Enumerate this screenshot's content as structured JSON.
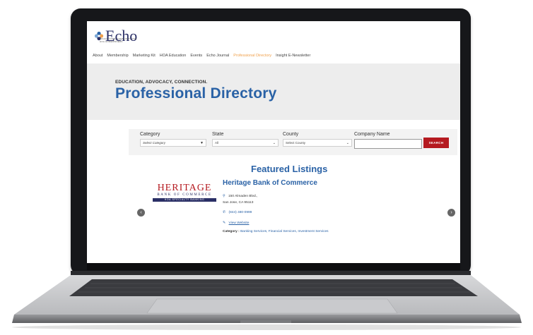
{
  "site": {
    "logo": {
      "word": "Echo",
      "tagline": "EDUCATIONAL COMMUNITY FOR HOA HOMEOWNERS"
    },
    "nav": [
      {
        "label": "About",
        "active": false
      },
      {
        "label": "Membership",
        "active": false
      },
      {
        "label": "Marketing Kit",
        "active": false
      },
      {
        "label": "HOA Education",
        "active": false
      },
      {
        "label": "Events",
        "active": false
      },
      {
        "label": "Echo Journal",
        "active": false
      },
      {
        "label": "Professional Directory",
        "active": true
      },
      {
        "label": "Insight E-Newsletter",
        "active": false
      }
    ],
    "hero": {
      "eyebrow": "EDUCATION, ADVOCACY, CONNECTION.",
      "title": "Professional Directory"
    },
    "filters": {
      "category": {
        "label": "Category",
        "value": "Select Category"
      },
      "state": {
        "label": "State",
        "value": "All"
      },
      "county": {
        "label": "County",
        "value": "Select County"
      },
      "company": {
        "label": "Company Name",
        "value": ""
      },
      "search_label": "SEARCH"
    },
    "featured": {
      "heading": "Featured Listings",
      "listing": {
        "name": "Heritage Bank of Commerce",
        "logo_text": {
          "main": "HERITAGE",
          "sub": "BANK OF COMMERCE",
          "band": "HOA SPECIALTY BANKING"
        },
        "address_line1": "150 Almaden Blvd.,",
        "address_line2": "San Jose, CA 95113",
        "phone": "(844) 480-0999",
        "website_label": "View Website",
        "category_label": "Category :",
        "category_value": "Banking Services, Financial Services, Investment Services"
      }
    }
  },
  "colors": {
    "brand_blue": "#2a62a6",
    "accent_orange": "#f0a04b",
    "search_red": "#b51a20",
    "logo_navy": "#2a2f66"
  }
}
